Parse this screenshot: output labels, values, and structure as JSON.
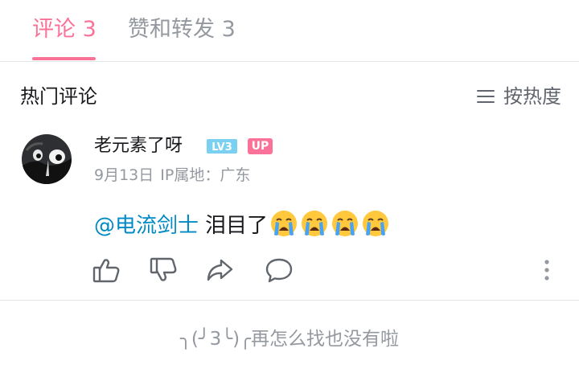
{
  "tabs": [
    {
      "label": "评论 3",
      "active": true
    },
    {
      "label": "赞和转发 3",
      "active": false
    }
  ],
  "section": {
    "title": "热门评论",
    "sort_label": "按热度"
  },
  "comment": {
    "username": "老元素了呀",
    "level_badge": "LV3",
    "up_badge": "UP",
    "meta": "9月13日  IP属地：广东",
    "mention": "@电流剑士",
    "text": "泪目了",
    "emojis": [
      "crying-face",
      "crying-face",
      "crying-face",
      "crying-face"
    ]
  },
  "end_text": "╮(╯3╰)╭再怎么找也没有啦",
  "colors": {
    "accent": "#fb7299",
    "mention": "#008ac5",
    "muted": "#9499a0",
    "level_badge": "#7ad0f0"
  }
}
